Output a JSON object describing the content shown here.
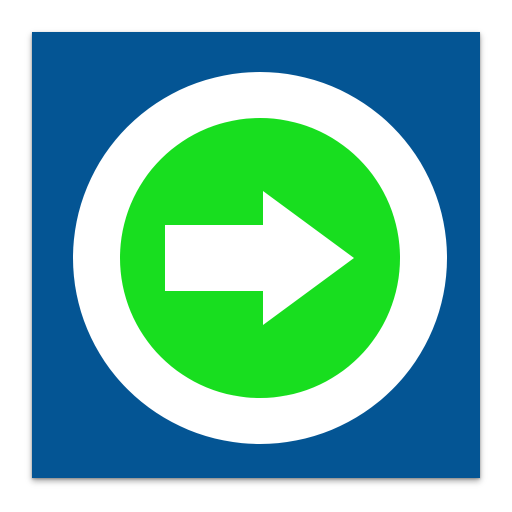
{
  "icon": {
    "name": "next-arrow-icon",
    "tile_color": "#045594",
    "ring_color": "#ffffff",
    "disc_color": "#18de1f",
    "arrow_color": "#ffffff"
  }
}
